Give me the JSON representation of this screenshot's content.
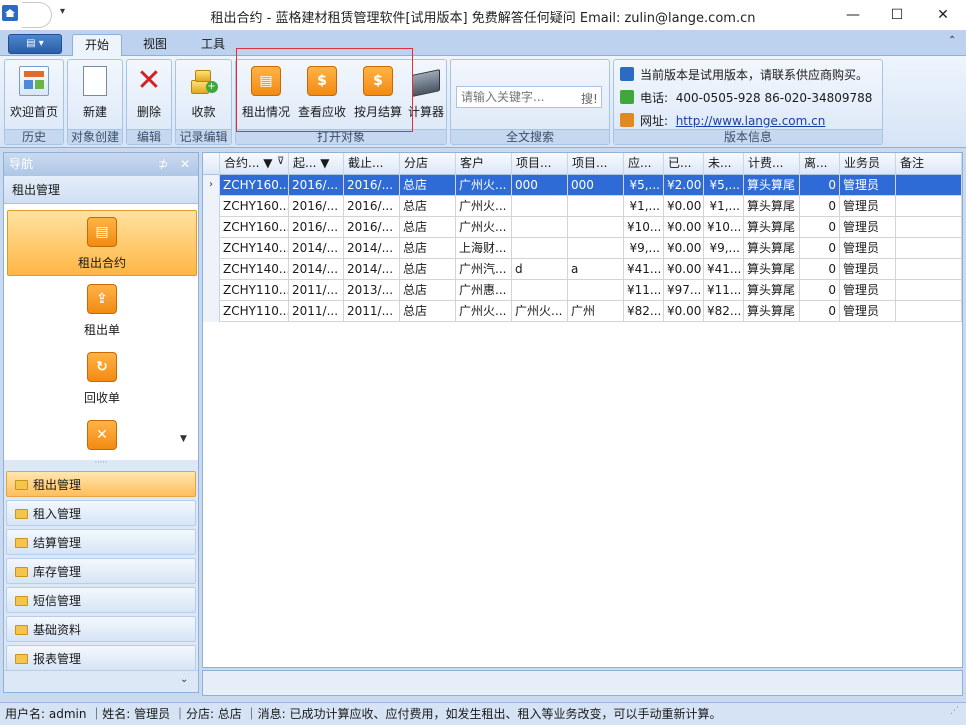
{
  "window": {
    "title": "租出合约 - 蓝格建材租赁管理软件[试用版本] 免费解答任何疑问 Email: zulin@lange.com.cn",
    "qat_menu": "▾",
    "min": "—",
    "max": "☐",
    "close": "✕"
  },
  "ribbon": {
    "app_button": "▤ ▾",
    "tabs": [
      "开始",
      "视图",
      "工具"
    ],
    "collapse": "⌃",
    "groups": {
      "history": {
        "label": "历史",
        "buttons": [
          "欢迎首页"
        ]
      },
      "create": {
        "label": "对象创建",
        "buttons": [
          "新建"
        ]
      },
      "edit": {
        "label": "编辑",
        "buttons": [
          "删除"
        ]
      },
      "record_edit": {
        "label": "记录编辑",
        "buttons": [
          "收款"
        ]
      },
      "open_object": {
        "label": "打开对象",
        "buttons": [
          "租出情况",
          "查看应收",
          "按月结算",
          "计算器"
        ]
      },
      "fulltext": {
        "label": "全文搜索",
        "placeholder": "请输入关键字...",
        "search_button": "搜!"
      },
      "version": {
        "label": "版本信息",
        "notice": "当前版本是试用版本，请联系供应商购买。",
        "phone_label": "电话:",
        "phone": "400-0505-928  86-020-34809788",
        "site_label": "网址:",
        "site": "http://www.lange.com.cn"
      }
    }
  },
  "nav": {
    "header": "导航",
    "pin": "⊅",
    "close": "✕",
    "group_title": "租出管理",
    "items": [
      "租出合约",
      "租出单",
      "回收单"
    ],
    "scroll_down": "▼",
    "splitter": "·····",
    "categories": [
      "租出管理",
      "租入管理",
      "结算管理",
      "库存管理",
      "短信管理",
      "基础资料",
      "报表管理"
    ],
    "bottom_chevron": "⌄"
  },
  "grid": {
    "columns": [
      "合约... ▼",
      "起... ▼",
      "截止...",
      "分店",
      "客户",
      "项目...",
      "项目...",
      "应...",
      "已...",
      "未...",
      "计费...",
      "离...",
      "业务员",
      "备注"
    ],
    "filter_icon": "⊽",
    "row_indicator": "›",
    "rows": [
      [
        "ZCHY160...",
        "2016/...",
        "2016/...",
        "总店",
        "广州火...",
        "000",
        "000",
        "¥5,...",
        "¥2.00",
        "¥5,...",
        "算头算尾",
        "0",
        "管理员",
        ""
      ],
      [
        "ZCHY160...",
        "2016/...",
        "2016/...",
        "总店",
        "广州火...",
        "",
        "",
        "¥1,...",
        "¥0.00",
        "¥1,...",
        "算头算尾",
        "0",
        "管理员",
        ""
      ],
      [
        "ZCHY160...",
        "2016/...",
        "2016/...",
        "总店",
        "广州火...",
        "",
        "",
        "¥10...",
        "¥0.00",
        "¥10...",
        "算头算尾",
        "0",
        "管理员",
        ""
      ],
      [
        "ZCHY140...",
        "2014/...",
        "2014/...",
        "总店",
        "上海财...",
        "",
        "",
        "¥9,...",
        "¥0.00",
        "¥9,...",
        "算头算尾",
        "0",
        "管理员",
        ""
      ],
      [
        "ZCHY140...",
        "2014/...",
        "2014/...",
        "总店",
        "广州汽...",
        "d",
        "a",
        "¥41...",
        "¥0.00",
        "¥41...",
        "算头算尾",
        "0",
        "管理员",
        ""
      ],
      [
        "ZCHY110...",
        "2011/...",
        "2013/...",
        "总店",
        "广州惠...",
        "",
        "",
        "¥11...",
        "¥97...",
        "¥11...",
        "算头算尾",
        "0",
        "管理员",
        ""
      ],
      [
        "ZCHY110...",
        "2011/...",
        "2011/...",
        "总店",
        "广州火...",
        "广州火...",
        "广州",
        "¥82...",
        "¥0.00",
        "¥82...",
        "算头算尾",
        "0",
        "管理员",
        ""
      ]
    ]
  },
  "status": {
    "text": "用户名: admin ｜姓名: 管理员 ｜分店: 总店 ｜消息: 已成功计算应收、应付费用，如发生租出、租入等业务改变，可以手动重新计算。",
    "grip": "⋰"
  },
  "colors": {
    "accent_orange": "#f28a12",
    "selection_blue": "#2f6bd6",
    "highlight_red": "#e0303c"
  }
}
